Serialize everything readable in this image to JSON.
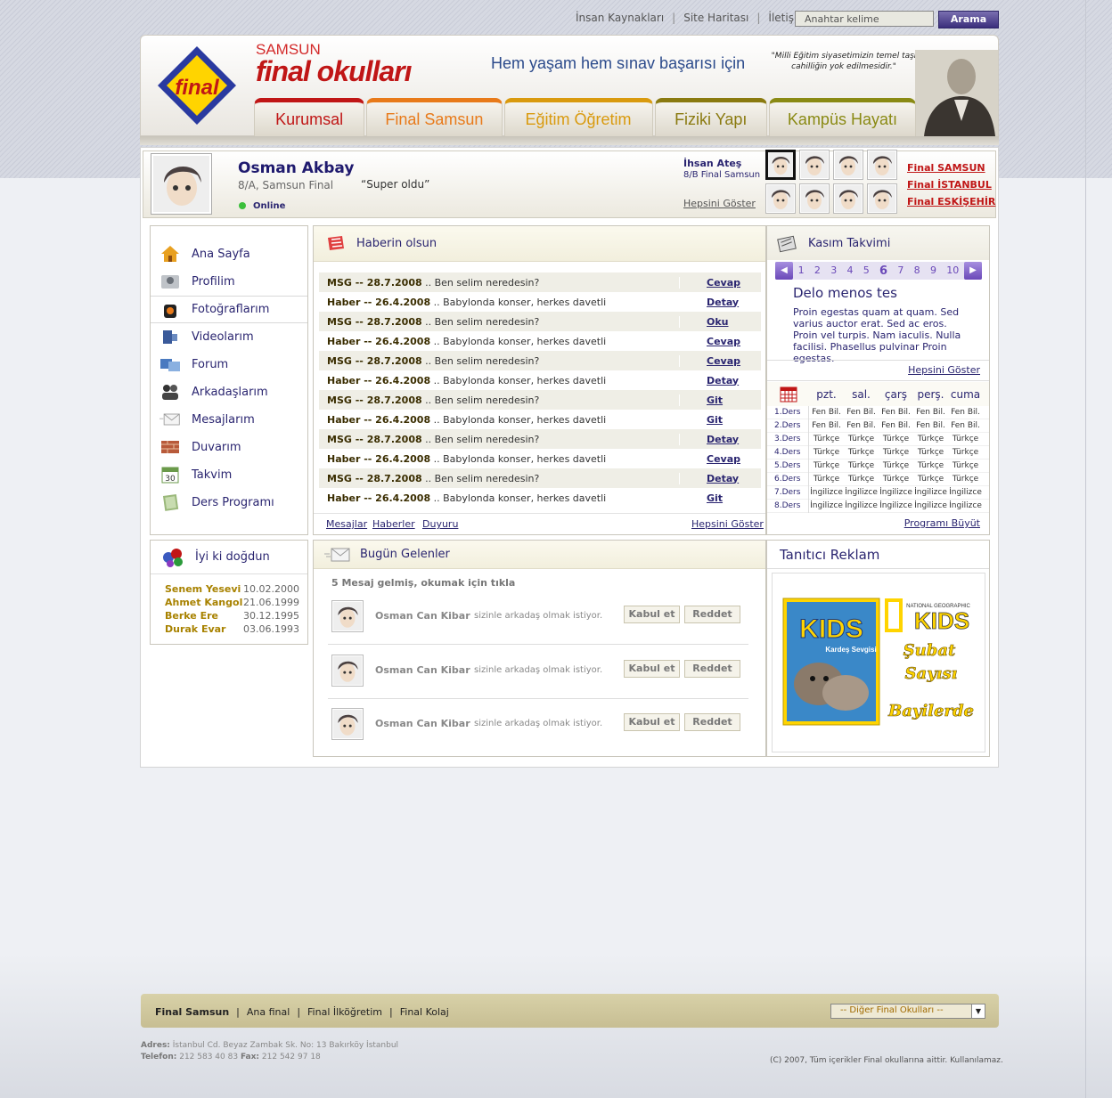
{
  "top_links": [
    "İnsan Kaynakları",
    "Site Haritası",
    "İletişim"
  ],
  "search": {
    "placeholder": "Anahtar kelime",
    "button": "Arama"
  },
  "header": {
    "logo_text": "final",
    "brand_small": "SAMSUN",
    "brand_big": "final okulları",
    "slogan": "Hem yaşam hem sınav başarısı için",
    "quote": "\"Milli Eğitim siyasetimizin temel taşı cahilliğin yok edilmesidir.\""
  },
  "nav_tabs": [
    {
      "label": "Kurumsal",
      "color": "#c01616"
    },
    {
      "label": "Final Samsun",
      "color": "#e87a1a"
    },
    {
      "label": "Eğitim Öğretim",
      "color": "#d99a0e"
    },
    {
      "label": "Fiziki Yapı",
      "color": "#8a7a10"
    },
    {
      "label": "Kampüs Hayatı",
      "color": "#8a8a14"
    }
  ],
  "profile": {
    "name": "Osman Akbay",
    "class": "8/A, Samsun Final",
    "status_quote": "“Super oldu”",
    "online": "Online",
    "friend_name": "İhsan Ateş",
    "friend_class": "8/B Final Samsun",
    "show_all": "Hepsini Göster"
  },
  "schools": [
    "Final SAMSUN",
    "Final İSTANBUL",
    "Final ESKİŞEHİR"
  ],
  "left_nav": [
    {
      "label": "Ana Sayfa",
      "icon": "home-icon"
    },
    {
      "label": "Profilim",
      "icon": "profile-icon"
    },
    {
      "label": "Fotoğraflarım",
      "icon": "camera-icon"
    },
    {
      "label": "Videolarım",
      "icon": "video-icon"
    },
    {
      "label": "Forum",
      "icon": "forum-icon"
    },
    {
      "label": "Arkadaşlarım",
      "icon": "friends-icon"
    },
    {
      "label": "Mesajlarım",
      "icon": "envelope-icon"
    },
    {
      "label": "Duvarım",
      "icon": "wall-icon"
    },
    {
      "label": "Takvim",
      "icon": "calendar-icon"
    },
    {
      "label": "Ders Programı",
      "icon": "book-icon"
    }
  ],
  "news": {
    "title": "Haberin olsun",
    "rows": [
      {
        "type": "MSG",
        "date": "28.7.2008",
        "text": "Ben selim neredesin?",
        "action": "Cevap"
      },
      {
        "type": "Haber",
        "date": "26.4.2008",
        "text": "Babylonda konser, herkes davetli",
        "action": "Detay"
      },
      {
        "type": "MSG",
        "date": "28.7.2008",
        "text": "Ben selim neredesin?",
        "action": "Oku"
      },
      {
        "type": "Haber",
        "date": "26.4.2008",
        "text": "Babylonda konser, herkes davetli",
        "action": "Cevap"
      },
      {
        "type": "MSG",
        "date": "28.7.2008",
        "text": "Ben selim neredesin?",
        "action": "Cevap"
      },
      {
        "type": "Haber",
        "date": "26.4.2008",
        "text": "Babylonda konser, herkes davetli",
        "action": "Detay"
      },
      {
        "type": "MSG",
        "date": "28.7.2008",
        "text": "Ben selim neredesin?",
        "action": "Git"
      },
      {
        "type": "Haber",
        "date": "26.4.2008",
        "text": "Babylonda konser, herkes davetli",
        "action": "Git"
      },
      {
        "type": "MSG",
        "date": "28.7.2008",
        "text": "Ben selim neredesin?",
        "action": "Detay"
      },
      {
        "type": "Haber",
        "date": "26.4.2008",
        "text": "Babylonda konser, herkes davetli",
        "action": "Cevap"
      },
      {
        "type": "MSG",
        "date": "28.7.2008",
        "text": "Ben selim neredesin?",
        "action": "Detay"
      },
      {
        "type": "Haber",
        "date": "26.4.2008",
        "text": "Babylonda konser, herkes davetli",
        "action": "Git"
      }
    ],
    "footer_links": [
      "Mesajlar",
      "Haberler",
      "Duyuru"
    ],
    "show_all": "Hepsini Göster"
  },
  "calendar": {
    "title": "Kasım Takvimi",
    "days": [
      "1",
      "2",
      "3",
      "4",
      "5",
      "6",
      "7",
      "8",
      "9",
      "10"
    ],
    "current_day": "6",
    "event_title": "Delo menos tes",
    "event_text": "Proin egestas quam at quam. Sed varius auctor erat. Sed ac eros. Proin vel turpis. Nam iaculis. Nulla facilisi. Phasellus pulvinar Proin egestas.",
    "show_all": "Hepsini Göster"
  },
  "schedule": {
    "days": [
      "pzt.",
      "sal.",
      "çarş",
      "perş.",
      "cuma"
    ],
    "rows": [
      {
        "lesson": "1.Ders",
        "cells": [
          "Fen Bil.",
          "Fen Bil.",
          "Fen Bil.",
          "Fen Bil.",
          "Fen Bil."
        ]
      },
      {
        "lesson": "2.Ders",
        "cells": [
          "Fen Bil.",
          "Fen Bil.",
          "Fen Bil.",
          "Fen Bil.",
          "Fen Bil."
        ]
      },
      {
        "lesson": "3.Ders",
        "cells": [
          "Türkçe",
          "Türkçe",
          "Türkçe",
          "Türkçe",
          "Türkçe"
        ]
      },
      {
        "lesson": "4.Ders",
        "cells": [
          "Türkçe",
          "Türkçe",
          "Türkçe",
          "Türkçe",
          "Türkçe"
        ]
      },
      {
        "lesson": "5.Ders",
        "cells": [
          "Türkçe",
          "Türkçe",
          "Türkçe",
          "Türkçe",
          "Türkçe"
        ]
      },
      {
        "lesson": "6.Ders",
        "cells": [
          "Türkçe",
          "Türkçe",
          "Türkçe",
          "Türkçe",
          "Türkçe"
        ]
      },
      {
        "lesson": "7.Ders",
        "cells": [
          "İngilizce",
          "İngilizce",
          "İngilizce",
          "İngilizce",
          "İngilizce"
        ]
      },
      {
        "lesson": "8.Ders",
        "cells": [
          "İngilizce",
          "İngilizce",
          "İngilizce",
          "İngilizce",
          "İngilizce"
        ]
      }
    ],
    "enlarge": "Programı Büyüt"
  },
  "birthdays": {
    "title": "İyi ki doğdun",
    "rows": [
      {
        "name": "Senem Yesevi",
        "date": "10.02.2000"
      },
      {
        "name": "Ahmet Kangol",
        "date": "21.06.1999"
      },
      {
        "name": "Berke Ere",
        "date": "30.12.1995"
      },
      {
        "name": "Durak Evar",
        "date": "03.06.1993"
      }
    ]
  },
  "incoming": {
    "title": "Bugün Gelenler",
    "note": "5 Mesaj gelmiş, okumak için tıkla",
    "requests": [
      {
        "name": "Osman Can Kibar",
        "message": "sizinle arkadaş olmak istiyor.",
        "accept": "Kabul et",
        "reject": "Reddet"
      },
      {
        "name": "Osman Can Kibar",
        "message": "sizinle arkadaş olmak istiyor.",
        "accept": "Kabul et",
        "reject": "Reddet"
      },
      {
        "name": "Osman Can Kibar",
        "message": "sizinle arkadaş olmak istiyor.",
        "accept": "Kabul et",
        "reject": "Reddet"
      }
    ]
  },
  "ad": {
    "title": "Tanıtıcı Reklam",
    "magazine_brand": "NATIONAL GEOGRAPHIC",
    "magazine_title": "KIDS",
    "magazine_cover_headline": "Kardeş Sevgisi",
    "promo_line1": "Şubat",
    "promo_line2": "Sayısı",
    "promo_line3": "Bayilerde"
  },
  "footer": {
    "links": [
      "Final Samsun",
      "Ana final",
      "Final İlköğretim",
      "Final Kolaj"
    ],
    "select_value": "-- Diğer Final Okulları --",
    "address_label": "Adres:",
    "address": "İstanbul Cd. Beyaz Zambak Sk. No: 13 Bakırköy İstanbul",
    "phone_label": "Telefon:",
    "phone": "212 583 40 83",
    "fax_label": "Fax:",
    "fax": "212 542 97 18",
    "copyright": "(C) 2007, Tüm içerikler Final okullarına aittir. Kullanılamaz."
  }
}
